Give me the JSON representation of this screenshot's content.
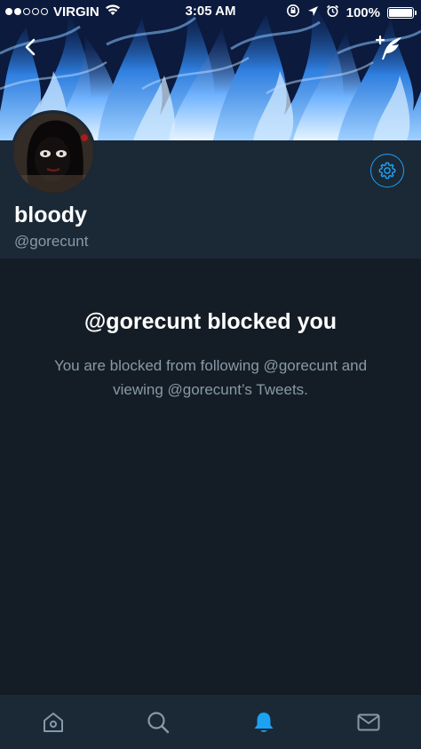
{
  "status_bar": {
    "carrier": "VIRGIN",
    "time": "3:05 AM",
    "battery": "100%",
    "signal_bars_full": 2,
    "signal_bars_total": 5
  },
  "profile": {
    "display_name": "bloody",
    "handle": "@gorecunt"
  },
  "blocked": {
    "title": "@gorecunt blocked you",
    "description": "You are blocked from following @gorecunt and viewing @gorecunt’s Tweets."
  },
  "tabs": [
    {
      "icon": "home-icon",
      "active": false
    },
    {
      "icon": "search-icon",
      "active": false
    },
    {
      "icon": "notifications-icon",
      "active": true
    },
    {
      "icon": "messages-icon",
      "active": false
    }
  ],
  "colors": {
    "accent": "#1da1f2",
    "background": "#141d26",
    "header_bg": "#1b2836",
    "muted_text": "#8899a6",
    "inactive_icon": "#8899a6"
  }
}
